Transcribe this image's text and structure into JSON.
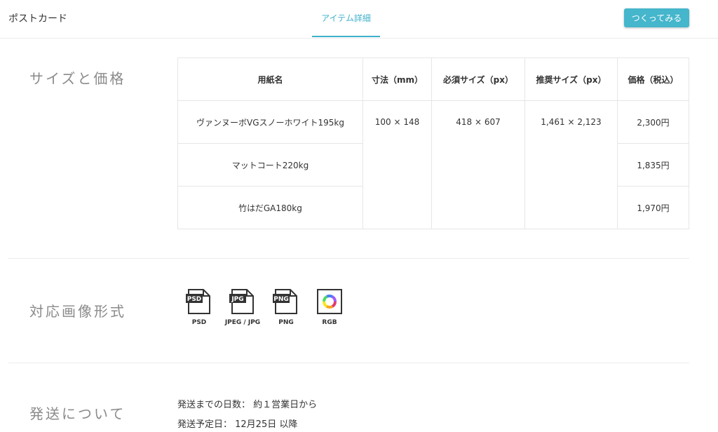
{
  "header": {
    "brand": "ポストカード",
    "tab": "アイテム詳細",
    "cta": "つくってみる"
  },
  "sections": {
    "size_price": "サイズと価格",
    "formats": "対応画像形式",
    "shipping": "発送について"
  },
  "table": {
    "headers": [
      "用紙名",
      "寸法（mm）",
      "必須サイズ（px）",
      "推奨サイズ（px）",
      "価格（税込）"
    ],
    "dimension": "100 × 148",
    "required_size": "418 × 607",
    "recommended_size": "1,461 × 2,123",
    "rows": [
      {
        "paper": "ヴァンヌーボVGスノーホワイト195kg",
        "price": "2,300円"
      },
      {
        "paper": "マットコート220kg",
        "price": "1,835円"
      },
      {
        "paper": "竹はだGA180kg",
        "price": "1,970円"
      }
    ]
  },
  "formats": [
    {
      "label": "PSD",
      "badge": "PSD",
      "icon": "psd-file-icon"
    },
    {
      "label": "JPEG / JPG",
      "badge": "JPG",
      "icon": "jpg-file-icon"
    },
    {
      "label": "PNG",
      "badge": "PNG",
      "icon": "png-file-icon"
    },
    {
      "label": "RGB",
      "badge": "",
      "icon": "rgb-color-wheel-icon"
    }
  ],
  "shipping": {
    "days": "発送までの日数： 約１営業日から",
    "date": "発送予定日： 12月25日 以降"
  },
  "colors": {
    "accent": "#45b6cc",
    "tab_text": "#3fb1cb",
    "section_title": "#8a8a8a",
    "border": "#e6e6e6"
  }
}
